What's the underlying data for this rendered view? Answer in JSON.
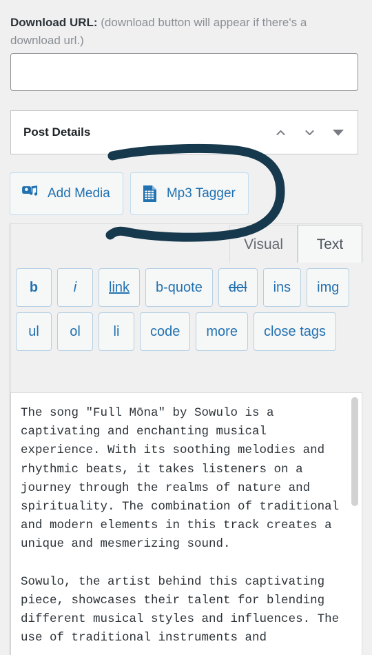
{
  "download_url_field": {
    "label_strong": "Download URL:",
    "label_hint": " (download button will appear if there's a download url.)",
    "value": "",
    "placeholder": ""
  },
  "post_details_box": {
    "title": "Post Details",
    "move_up_icon": "chevron-up-icon",
    "move_down_icon": "chevron-down-icon",
    "toggle_icon": "triangle-down-icon"
  },
  "media_buttons": [
    {
      "label": "Add Media",
      "icon": "add-media-icon"
    },
    {
      "label": "Mp3 Tagger",
      "icon": "mp3-tagger-icon"
    }
  ],
  "editor": {
    "tabs": [
      {
        "label": "Visual",
        "active": false
      },
      {
        "label": "Text",
        "active": true
      }
    ],
    "quicktags": [
      {
        "label": "b",
        "style": "b"
      },
      {
        "label": "i",
        "style": "i"
      },
      {
        "label": "link",
        "style": "link"
      },
      {
        "label": "b-quote",
        "style": ""
      },
      {
        "label": "del",
        "style": "del"
      },
      {
        "label": "ins",
        "style": ""
      },
      {
        "label": "img",
        "style": ""
      },
      {
        "label": "ul",
        "style": ""
      },
      {
        "label": "ol",
        "style": ""
      },
      {
        "label": "li",
        "style": ""
      },
      {
        "label": "code",
        "style": ""
      },
      {
        "label": "more",
        "style": ""
      },
      {
        "label": "close tags",
        "style": ""
      }
    ],
    "content": "The song \"Full Mōna\" by Sowulo is a captivating and enchanting musical experience. With its soothing melodies and rhythmic beats, it takes listeners on a journey through the realms of nature and spirituality. The combination of traditional and modern elements in this track creates a unique and mesmerizing sound.\n\nSowulo, the artist behind this captivating piece, showcases their talent for blending different musical styles and influences. The use of traditional instruments and"
  },
  "annotation": {
    "shape": "hand-drawn-oval",
    "target": "Mp3 Tagger",
    "color": "#17394d"
  },
  "colors": {
    "page_background": "#f0f0f1",
    "accent_link": "#2271b1",
    "text_primary": "#1d2327",
    "text_muted": "#8a8f94",
    "annotation": "#17394d"
  }
}
